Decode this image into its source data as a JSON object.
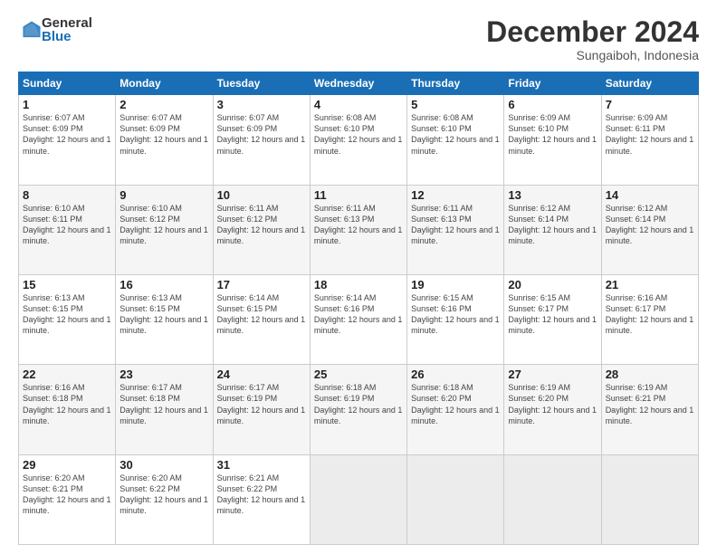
{
  "logo": {
    "general": "General",
    "blue": "Blue"
  },
  "title": "December 2024",
  "subtitle": "Sungaiboh, Indonesia",
  "days_of_week": [
    "Sunday",
    "Monday",
    "Tuesday",
    "Wednesday",
    "Thursday",
    "Friday",
    "Saturday"
  ],
  "weeks": [
    [
      {
        "day": "1",
        "sunrise": "6:07 AM",
        "sunset": "6:09 PM",
        "daylight": "12 hours and 1 minute."
      },
      {
        "day": "2",
        "sunrise": "6:07 AM",
        "sunset": "6:09 PM",
        "daylight": "12 hours and 1 minute."
      },
      {
        "day": "3",
        "sunrise": "6:07 AM",
        "sunset": "6:09 PM",
        "daylight": "12 hours and 1 minute."
      },
      {
        "day": "4",
        "sunrise": "6:08 AM",
        "sunset": "6:10 PM",
        "daylight": "12 hours and 1 minute."
      },
      {
        "day": "5",
        "sunrise": "6:08 AM",
        "sunset": "6:10 PM",
        "daylight": "12 hours and 1 minute."
      },
      {
        "day": "6",
        "sunrise": "6:09 AM",
        "sunset": "6:10 PM",
        "daylight": "12 hours and 1 minute."
      },
      {
        "day": "7",
        "sunrise": "6:09 AM",
        "sunset": "6:11 PM",
        "daylight": "12 hours and 1 minute."
      }
    ],
    [
      {
        "day": "8",
        "sunrise": "6:10 AM",
        "sunset": "6:11 PM",
        "daylight": "12 hours and 1 minute."
      },
      {
        "day": "9",
        "sunrise": "6:10 AM",
        "sunset": "6:12 PM",
        "daylight": "12 hours and 1 minute."
      },
      {
        "day": "10",
        "sunrise": "6:11 AM",
        "sunset": "6:12 PM",
        "daylight": "12 hours and 1 minute."
      },
      {
        "day": "11",
        "sunrise": "6:11 AM",
        "sunset": "6:13 PM",
        "daylight": "12 hours and 1 minute."
      },
      {
        "day": "12",
        "sunrise": "6:11 AM",
        "sunset": "6:13 PM",
        "daylight": "12 hours and 1 minute."
      },
      {
        "day": "13",
        "sunrise": "6:12 AM",
        "sunset": "6:14 PM",
        "daylight": "12 hours and 1 minute."
      },
      {
        "day": "14",
        "sunrise": "6:12 AM",
        "sunset": "6:14 PM",
        "daylight": "12 hours and 1 minute."
      }
    ],
    [
      {
        "day": "15",
        "sunrise": "6:13 AM",
        "sunset": "6:15 PM",
        "daylight": "12 hours and 1 minute."
      },
      {
        "day": "16",
        "sunrise": "6:13 AM",
        "sunset": "6:15 PM",
        "daylight": "12 hours and 1 minute."
      },
      {
        "day": "17",
        "sunrise": "6:14 AM",
        "sunset": "6:15 PM",
        "daylight": "12 hours and 1 minute."
      },
      {
        "day": "18",
        "sunrise": "6:14 AM",
        "sunset": "6:16 PM",
        "daylight": "12 hours and 1 minute."
      },
      {
        "day": "19",
        "sunrise": "6:15 AM",
        "sunset": "6:16 PM",
        "daylight": "12 hours and 1 minute."
      },
      {
        "day": "20",
        "sunrise": "6:15 AM",
        "sunset": "6:17 PM",
        "daylight": "12 hours and 1 minute."
      },
      {
        "day": "21",
        "sunrise": "6:16 AM",
        "sunset": "6:17 PM",
        "daylight": "12 hours and 1 minute."
      }
    ],
    [
      {
        "day": "22",
        "sunrise": "6:16 AM",
        "sunset": "6:18 PM",
        "daylight": "12 hours and 1 minute."
      },
      {
        "day": "23",
        "sunrise": "6:17 AM",
        "sunset": "6:18 PM",
        "daylight": "12 hours and 1 minute."
      },
      {
        "day": "24",
        "sunrise": "6:17 AM",
        "sunset": "6:19 PM",
        "daylight": "12 hours and 1 minute."
      },
      {
        "day": "25",
        "sunrise": "6:18 AM",
        "sunset": "6:19 PM",
        "daylight": "12 hours and 1 minute."
      },
      {
        "day": "26",
        "sunrise": "6:18 AM",
        "sunset": "6:20 PM",
        "daylight": "12 hours and 1 minute."
      },
      {
        "day": "27",
        "sunrise": "6:19 AM",
        "sunset": "6:20 PM",
        "daylight": "12 hours and 1 minute."
      },
      {
        "day": "28",
        "sunrise": "6:19 AM",
        "sunset": "6:21 PM",
        "daylight": "12 hours and 1 minute."
      }
    ],
    [
      {
        "day": "29",
        "sunrise": "6:20 AM",
        "sunset": "6:21 PM",
        "daylight": "12 hours and 1 minute."
      },
      {
        "day": "30",
        "sunrise": "6:20 AM",
        "sunset": "6:22 PM",
        "daylight": "12 hours and 1 minute."
      },
      {
        "day": "31",
        "sunrise": "6:21 AM",
        "sunset": "6:22 PM",
        "daylight": "12 hours and 1 minute."
      },
      null,
      null,
      null,
      null
    ]
  ]
}
